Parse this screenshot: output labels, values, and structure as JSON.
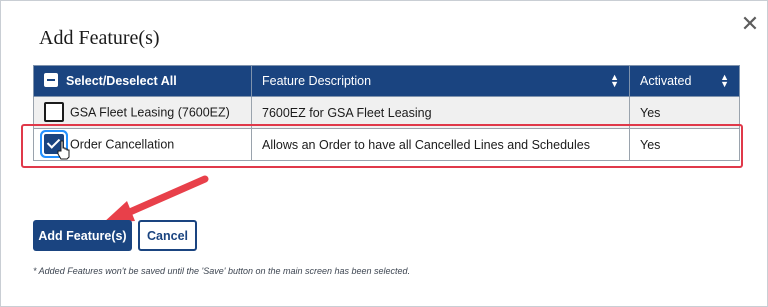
{
  "dialog": {
    "title": "Add Feature(s)",
    "close_icon": "close-icon"
  },
  "table": {
    "headers": {
      "select": "Select/Deselect All",
      "description": "Feature Description",
      "activated": "Activated"
    },
    "rows": [
      {
        "name": "GSA Fleet Leasing (7600EZ)",
        "description": "7600EZ for GSA Fleet Leasing",
        "activated": "Yes",
        "checked": false
      },
      {
        "name": "Order Cancellation",
        "description": "Allows an Order to have all Cancelled Lines and Schedules",
        "activated": "Yes",
        "checked": true
      }
    ]
  },
  "buttons": {
    "add": "Add Feature(s)",
    "cancel": "Cancel"
  },
  "footnote": "* Added Features won't be saved until the 'Save' button on the main screen has been selected.",
  "colors": {
    "primary": "#1a4480",
    "highlight": "#e0394a",
    "arrow": "#e8404a"
  }
}
